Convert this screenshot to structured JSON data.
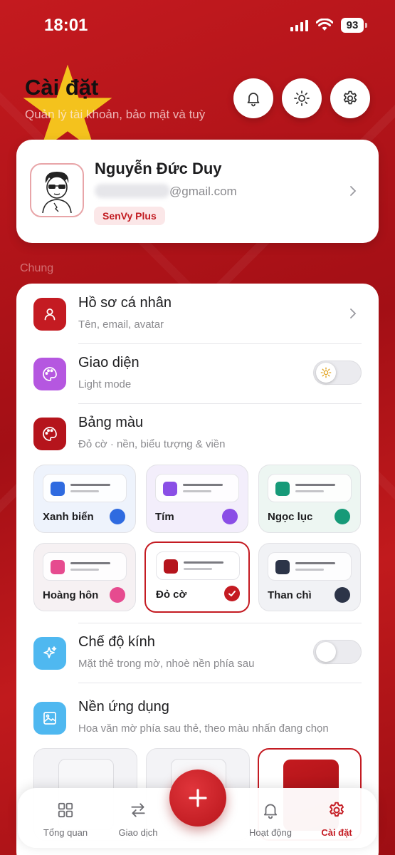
{
  "status_bar": {
    "time": "18:01",
    "battery": "93"
  },
  "header": {
    "title": "Cài đặt",
    "subtitle": "Quản lý tài khoản, bảo mật và tuỳ"
  },
  "profile": {
    "name": "Nguyễn Đức Duy",
    "email_domain": "@gmail.com",
    "badge": "SenVy Plus"
  },
  "section_label": "Chung",
  "rows": {
    "profile": {
      "title": "Hồ sơ cá nhân",
      "subtitle": "Tên, email, avatar"
    },
    "appearance": {
      "title": "Giao diện",
      "subtitle": "Light mode"
    },
    "palette": {
      "title": "Bảng màu",
      "subtitle": "Đỏ cờ · nền, biểu tượng & viền"
    },
    "glass": {
      "title": "Chế độ kính",
      "subtitle": "Mặt thẻ trong mờ, nhoè nền phía sau"
    },
    "background": {
      "title": "Nền ứng dụng",
      "subtitle": "Hoa văn mờ phía sau thẻ, theo màu nhấn đang chọn"
    }
  },
  "palettes": [
    {
      "name": "Xanh biển",
      "color": "#2f6be0",
      "tint": "#eef3fc"
    },
    {
      "name": "Tím",
      "color": "#8a4ee6",
      "tint": "#f3eefb"
    },
    {
      "name": "Ngọc lục",
      "color": "#169a78",
      "tint": "#edf6f2"
    },
    {
      "name": "Hoàng hôn",
      "color": "#e64b8f",
      "tint": "#f6f1f3"
    },
    {
      "name": "Đỏ cờ",
      "color": "#b5141c",
      "tint": "#ffffff",
      "selected": true
    },
    {
      "name": "Than chì",
      "color": "#2c3448",
      "tint": "#f1f2f5"
    }
  ],
  "tabs": [
    {
      "label": "Tổng quan",
      "icon": "grid-icon"
    },
    {
      "label": "Giao dịch",
      "icon": "swap-icon"
    },
    {
      "label": "Hoạt động",
      "icon": "bell-icon"
    },
    {
      "label": "Cài đặt",
      "icon": "gear-icon",
      "active": true
    }
  ],
  "colors": {
    "accent": "#c41b22",
    "background": "#b4141a"
  }
}
